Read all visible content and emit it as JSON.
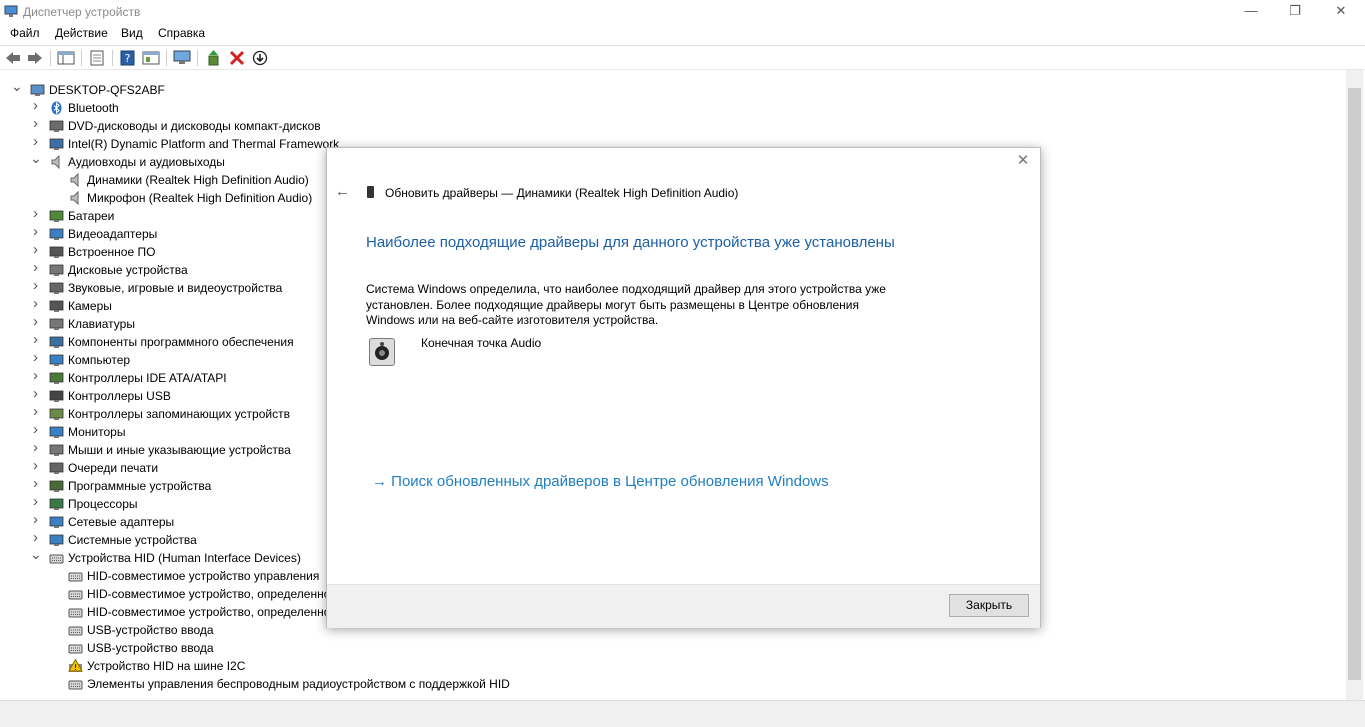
{
  "window": {
    "title": "Диспетчер устройств"
  },
  "menu": [
    "Файл",
    "Действие",
    "Вид",
    "Справка"
  ],
  "tree": [
    {
      "label": "DESKTOP-QFS2ABF",
      "level": 0,
      "expanded": true,
      "icon": "computer-icon"
    },
    {
      "label": "Bluetooth",
      "level": 1,
      "expanded": false,
      "icon": "bluetooth-icon"
    },
    {
      "label": "DVD-дисководы и дисководы компакт-дисков",
      "level": 1,
      "expanded": false,
      "icon": "dvd-icon"
    },
    {
      "label": "Intel(R) Dynamic Platform and Thermal Framework",
      "level": 1,
      "expanded": false,
      "icon": "chip-icon"
    },
    {
      "label": "Аудиовходы и аудиовыходы",
      "level": 1,
      "expanded": true,
      "icon": "speaker-icon"
    },
    {
      "label": "Динамики (Realtek High Definition Audio)",
      "level": 2,
      "icon": "speaker-icon"
    },
    {
      "label": "Микрофон (Realtek High Definition Audio)",
      "level": 2,
      "icon": "speaker-icon"
    },
    {
      "label": "Батареи",
      "level": 1,
      "expanded": false,
      "icon": "battery-icon"
    },
    {
      "label": "Видеоадаптеры",
      "level": 1,
      "expanded": false,
      "icon": "display-adapter-icon"
    },
    {
      "label": "Встроенное ПО",
      "level": 1,
      "expanded": false,
      "icon": "firmware-icon"
    },
    {
      "label": "Дисковые устройства",
      "level": 1,
      "expanded": false,
      "icon": "disk-icon"
    },
    {
      "label": "Звуковые, игровые и видеоустройства",
      "level": 1,
      "expanded": false,
      "icon": "sound-icon"
    },
    {
      "label": "Камеры",
      "level": 1,
      "expanded": false,
      "icon": "camera-icon"
    },
    {
      "label": "Клавиатуры",
      "level": 1,
      "expanded": false,
      "icon": "keyboard-icon"
    },
    {
      "label": "Компоненты программного обеспечения",
      "level": 1,
      "expanded": false,
      "icon": "software-icon"
    },
    {
      "label": "Компьютер",
      "level": 1,
      "expanded": false,
      "icon": "monitor-icon"
    },
    {
      "label": "Контроллеры IDE ATA/ATAPI",
      "level": 1,
      "expanded": false,
      "icon": "ide-icon"
    },
    {
      "label": "Контроллеры USB",
      "level": 1,
      "expanded": false,
      "icon": "usb-icon"
    },
    {
      "label": "Контроллеры запоминающих устройств",
      "level": 1,
      "expanded": false,
      "icon": "storage-icon"
    },
    {
      "label": "Мониторы",
      "level": 1,
      "expanded": false,
      "icon": "monitor-icon"
    },
    {
      "label": "Мыши и иные указывающие устройства",
      "level": 1,
      "expanded": false,
      "icon": "mouse-icon"
    },
    {
      "label": "Очереди печати",
      "level": 1,
      "expanded": false,
      "icon": "printer-icon"
    },
    {
      "label": "Программные устройства",
      "level": 1,
      "expanded": false,
      "icon": "software-device-icon"
    },
    {
      "label": "Процессоры",
      "level": 1,
      "expanded": false,
      "icon": "processor-icon"
    },
    {
      "label": "Сетевые адаптеры",
      "level": 1,
      "expanded": false,
      "icon": "network-icon"
    },
    {
      "label": "Системные устройства",
      "level": 1,
      "expanded": false,
      "icon": "system-icon"
    },
    {
      "label": "Устройства HID (Human Interface Devices)",
      "level": 1,
      "expanded": true,
      "icon": "hid-icon"
    },
    {
      "label": "HID-совместимое устройство управления",
      "level": 2,
      "icon": "hid-icon"
    },
    {
      "label": "HID-совместимое устройство, определенное поставщиком",
      "level": 2,
      "icon": "hid-icon"
    },
    {
      "label": "HID-совместимое устройство, определенное поставщиком",
      "level": 2,
      "icon": "hid-icon"
    },
    {
      "label": "USB-устройство ввода",
      "level": 2,
      "icon": "hid-icon"
    },
    {
      "label": "USB-устройство ввода",
      "level": 2,
      "icon": "hid-icon"
    },
    {
      "label": "Устройство HID на шине I2C",
      "level": 2,
      "icon": "warning-icon"
    },
    {
      "label": "Элементы управления беспроводным радиоустройством с поддержкой HID",
      "level": 2,
      "icon": "hid-icon"
    }
  ],
  "dialog": {
    "title": "Обновить драйверы — Динамики (Realtek High Definition Audio)",
    "heading": "Наиболее подходящие драйверы для данного устройства уже установлены",
    "description": "Система Windows определила, что наиболее подходящий драйвер для этого устройства уже установлен. Более подходящие драйверы могут быть размещены в Центре обновления Windows или на веб-сайте изготовителя устройства.",
    "device_name": "Конечная точка Audio",
    "link": "Поиск обновленных драйверов в Центре обновления Windows",
    "close_button": "Закрыть"
  },
  "colors": {
    "heading": "#1b5fa8",
    "link": "#1f7fc0",
    "toolbar_red": "#d32020"
  }
}
